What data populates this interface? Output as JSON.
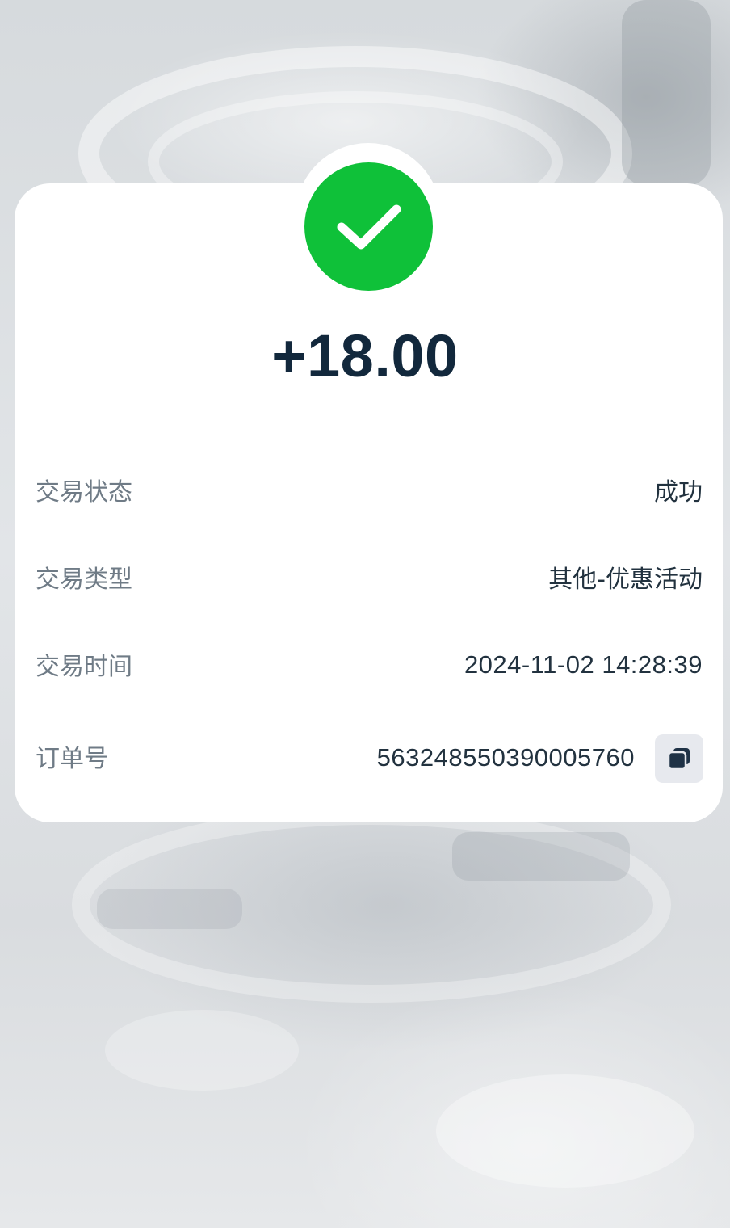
{
  "transaction": {
    "amount": "+18.00",
    "status_icon": "check-circle-icon",
    "accent_color": "#0fc139"
  },
  "details": {
    "status": {
      "label": "交易状态",
      "value": "成功"
    },
    "type": {
      "label": "交易类型",
      "value": "其他-优惠活动"
    },
    "time": {
      "label": "交易时间",
      "value": "2024-11-02 14:28:39"
    },
    "order": {
      "label": "订单号",
      "value": "5632485503900057​60",
      "copy_icon": "copy-icon"
    }
  }
}
